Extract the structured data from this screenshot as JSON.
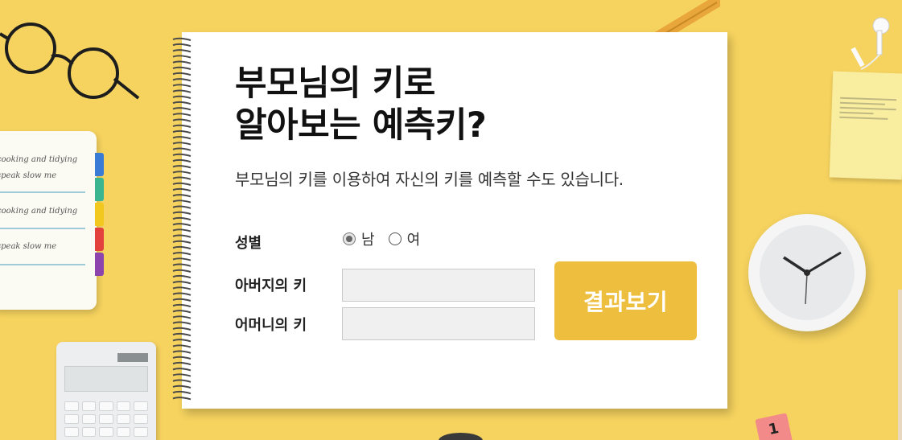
{
  "page": {
    "title_line1": "부모님의 키로",
    "title_line2": "알아보는 예측키?",
    "subtitle": "부모님의 키를 이용하여 자신의 키를 예측할 수도 있습니다."
  },
  "form": {
    "gender_label": "성별",
    "gender_options": [
      {
        "label": "남",
        "checked": true
      },
      {
        "label": "여",
        "checked": false
      }
    ],
    "father_label": "아버지의 키",
    "father_value": "",
    "mother_label": "어머니의 키",
    "mother_value": "",
    "submit_label": "결과보기"
  },
  "decor": {
    "sticky_left_lines": [
      "cooking and tidying",
      "speak slow me",
      "cooking and tidying",
      "speak slow me"
    ],
    "tab_colors": [
      "#3a7bd5",
      "#3bb58f",
      "#f2c81e",
      "#e2413d",
      "#8e44ad"
    ],
    "calendar_tag": "1"
  },
  "colors": {
    "background": "#f6d35f",
    "button": "#eebf3e",
    "button_text": "#ffffff"
  }
}
